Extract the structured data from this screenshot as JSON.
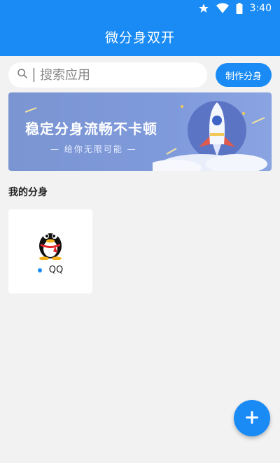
{
  "status_bar": {
    "time": "3:40",
    "icons": [
      "star-icon",
      "wifi-icon",
      "battery-icon"
    ]
  },
  "app_bar": {
    "title": "微分身双开"
  },
  "search": {
    "placeholder": "搜索应用",
    "button_label": "制作分身"
  },
  "banner": {
    "title": "稳定分身流畅不卡顿",
    "subtitle": "— 给你无限可能 —"
  },
  "section": {
    "title": "我的分身"
  },
  "clones": [
    {
      "name": "QQ",
      "icon": "qq-penguin-icon",
      "status_color": "#1a8bf5"
    }
  ],
  "fab": {
    "icon": "plus-icon"
  },
  "colors": {
    "primary": "#1a8bf5",
    "background": "#f2f2f2",
    "banner": "#7f9adb"
  }
}
